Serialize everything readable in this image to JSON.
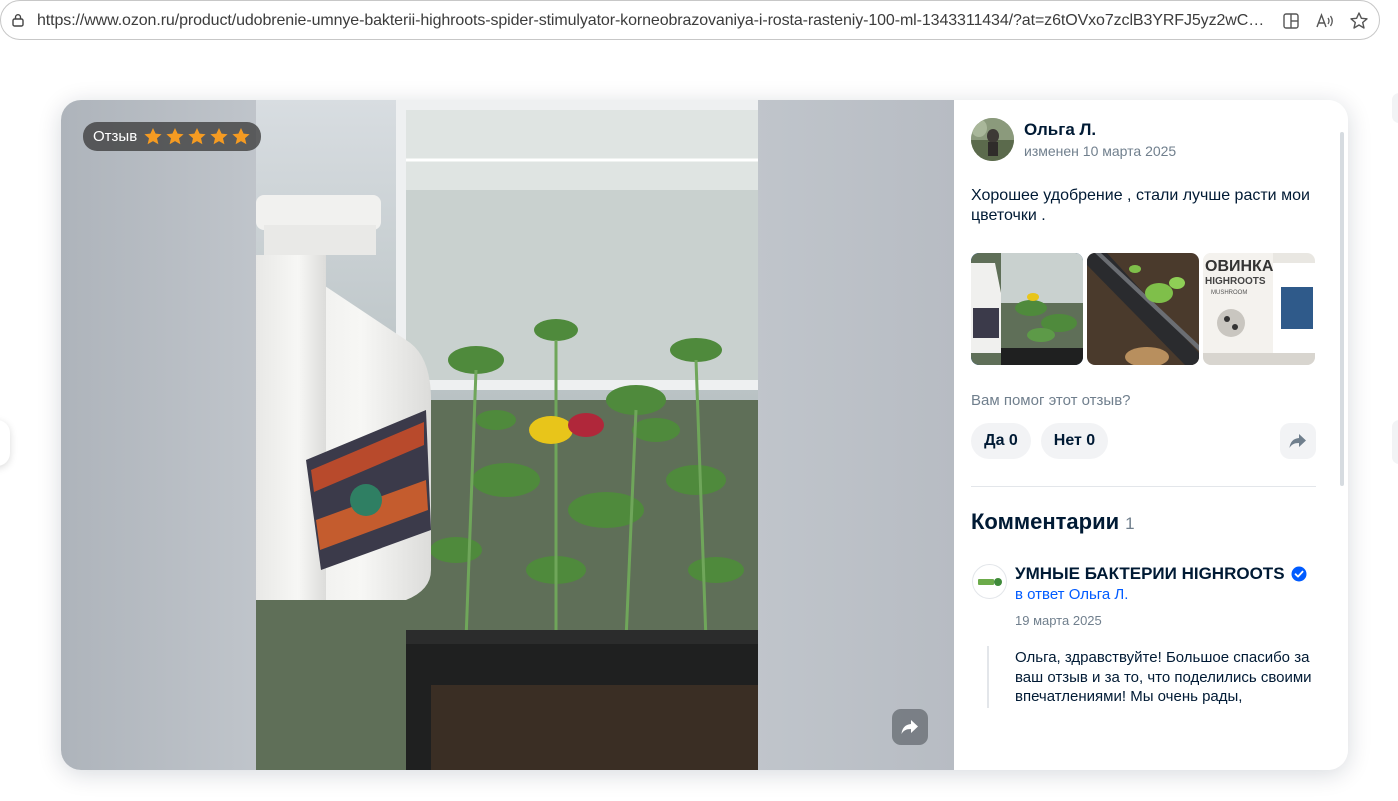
{
  "browser": {
    "url": "https://www.ozon.ru/product/udobrenie-umnye-bakterii-highroots-spider-stimulyator-korneobrazovaniya-i-rosta-rasteniy-100-ml-1343311434/?at=z6tOVxo7zclB3YRFJ5yz2wCJlqnR..."
  },
  "badge": {
    "label": "Отзыв",
    "rating": 5,
    "max": 5,
    "star_color": "#f59b22"
  },
  "review": {
    "author": "Ольга Л.",
    "edited": "изменен 10 марта 2025",
    "text": "Хорошее удобрение , стали лучше расти мои цветочки ."
  },
  "helpful": {
    "question": "Вам помог этот отзыв?",
    "yes": "Да 0",
    "no": "Нет 0"
  },
  "comments": {
    "title": "Комментарии",
    "count": "1",
    "items": [
      {
        "author": "УМНЫЕ БАКТЕРИИ HIGHROOTS",
        "reply_to": "в ответ Ольга Л.",
        "date": "19 марта 2025",
        "text": "Ольга, здравствуйте! Большое спасибо за ваш отзыв и за то, что поделились своими впечатлениями! Мы очень рады,"
      }
    ]
  },
  "colors": {
    "link": "#005bff",
    "verified": "#005bff",
    "text": "#001a34",
    "muted": "#707f8d"
  },
  "icons": [
    "lock-icon",
    "split-screen-icon",
    "read-aloud-icon",
    "favorite-star-icon",
    "share-icon",
    "verified-icon"
  ]
}
